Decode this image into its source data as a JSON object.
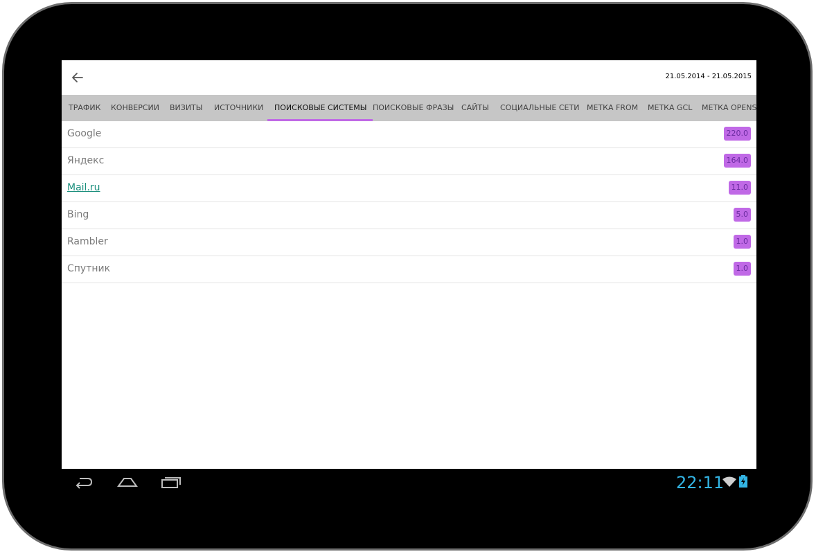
{
  "app": {
    "date_range": "21.05.2014 - 21.05.2015",
    "back_icon": "arrow-back-icon"
  },
  "tabs": [
    {
      "label": "ТРАФИК"
    },
    {
      "label": "КОНВЕРСИИ"
    },
    {
      "label": "ВИЗИТЫ"
    },
    {
      "label": "ИСТОЧНИКИ"
    },
    {
      "label": "ПОИСКОВЫЕ СИСТЕМЫ",
      "active": true
    },
    {
      "label": "ПОИСКОВЫЕ ФРАЗЫ"
    },
    {
      "label": "САЙТЫ"
    },
    {
      "label": "СОЦИАЛЬНЫЕ СЕТИ"
    },
    {
      "label": "МЕТКА FROM"
    },
    {
      "label": "МЕТКА GCL"
    },
    {
      "label": "МЕТКА OPENST"
    }
  ],
  "rows": [
    {
      "name": "Google",
      "value": "220.0"
    },
    {
      "name": "Яндекс",
      "value": "164.0"
    },
    {
      "name": "Mail.ru",
      "value": "11.0",
      "link": true
    },
    {
      "name": "Bing",
      "value": "5.0"
    },
    {
      "name": "Rambler",
      "value": "1.0"
    },
    {
      "name": "Спутник",
      "value": "1.0"
    }
  ],
  "system": {
    "time": "22:11",
    "icons": [
      "back-nav-icon",
      "home-nav-icon",
      "recents-nav-icon",
      "wifi-icon",
      "battery-charging-icon"
    ]
  },
  "colors": {
    "accent": "#c069e6",
    "tab_bar": "#c6c6c6",
    "link": "#1b8f7d",
    "clock": "#33b5e5"
  }
}
